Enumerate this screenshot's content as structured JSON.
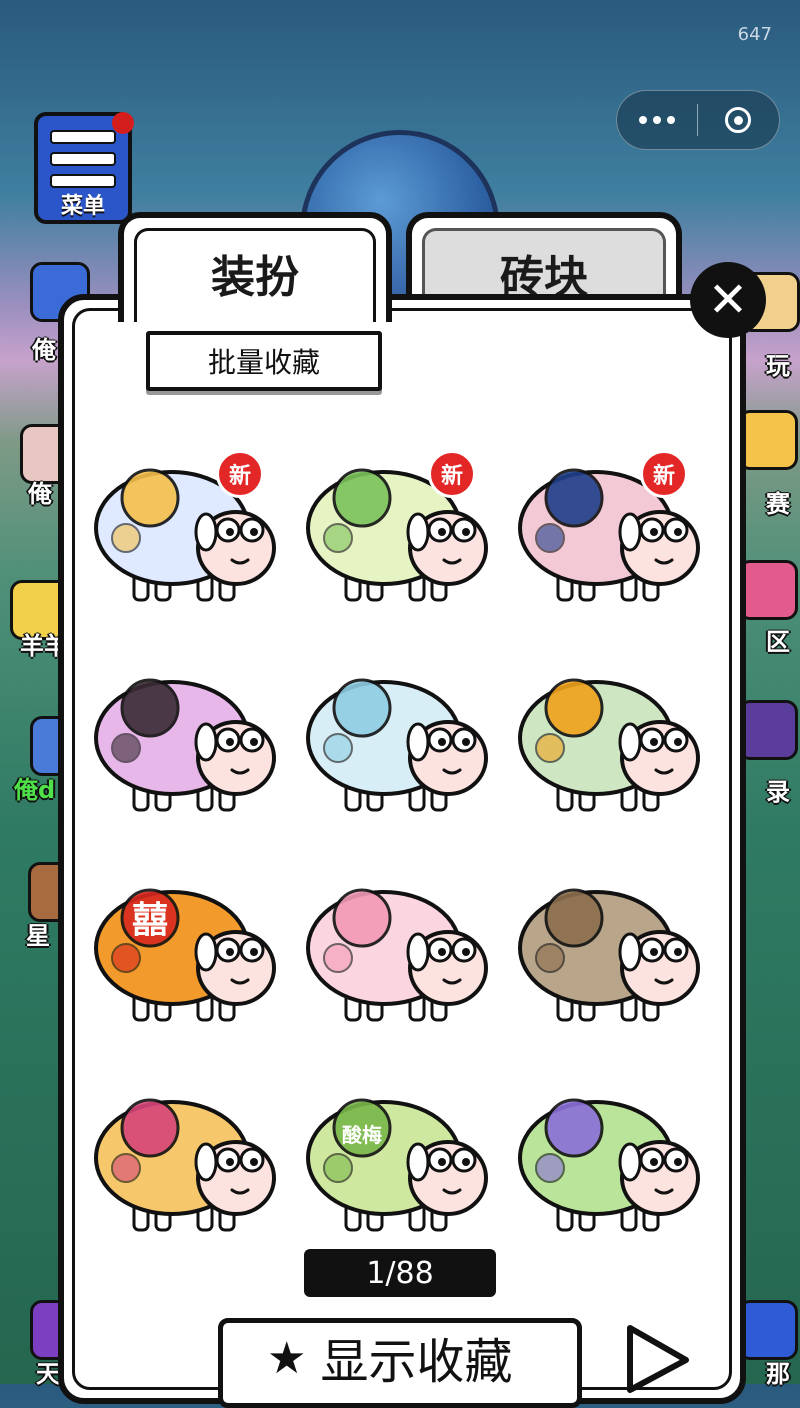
{
  "status": {
    "counter": "647"
  },
  "menu": {
    "label": "菜单"
  },
  "side_left": [
    "俺",
    "俺",
    "羊羊",
    "俺d",
    "星",
    "天"
  ],
  "side_right": [
    "玩",
    "赛",
    "区",
    "录",
    "那"
  ],
  "tabs": [
    {
      "label": "装扮",
      "active": true
    },
    {
      "label": "砖块",
      "active": false
    }
  ],
  "batch_button": "批量收藏",
  "items": [
    {
      "name": "moon-night-sheep",
      "new_badge": "新",
      "body": "#dfe9ff",
      "accent": "#f5c04a"
    },
    {
      "name": "green-fan-girl-sheep",
      "new_badge": "新",
      "body": "#e6f4c4",
      "accent": "#7cc35b"
    },
    {
      "name": "pink-hair-schoolbag-sheep",
      "new_badge": "新",
      "body": "#f4c9d6",
      "accent": "#1f3f8a"
    },
    {
      "name": "witch-halloween-sheep",
      "new_badge": "",
      "body": "#e6b7e8",
      "accent": "#3a2b35"
    },
    {
      "name": "harp-bunny-sheep",
      "new_badge": "",
      "body": "#d8eef6",
      "accent": "#8ecde3"
    },
    {
      "name": "gourd-elder-sheep",
      "new_badge": "",
      "body": "#cfe6c2",
      "accent": "#f0a21b"
    },
    {
      "name": "matchbox-sheep",
      "new_badge": "",
      "body": "#f39a2d",
      "accent": "#d8281e",
      "label": "囍"
    },
    {
      "name": "vanity-table-sheep",
      "new_badge": "",
      "body": "#fbd6e0",
      "accent": "#f49ab6"
    },
    {
      "name": "detective-sheep",
      "new_badge": "",
      "body": "#b9a58a",
      "accent": "#8c6e4c"
    },
    {
      "name": "passionfruit-sheep",
      "new_badge": "",
      "body": "#f7c86b",
      "accent": "#d7457a"
    },
    {
      "name": "plum-drink-sheep",
      "new_badge": "",
      "body": "#cfe89f",
      "accent": "#79b84a",
      "label": "酸梅"
    },
    {
      "name": "cat-garden-sheep",
      "new_badge": "",
      "body": "#b9e49a",
      "accent": "#8b6fd9"
    }
  ],
  "pagination": {
    "current": "1/88"
  },
  "show_favorites": {
    "label": "显示收藏",
    "icon": "star-icon"
  },
  "colors": {
    "panel_border": "#111111",
    "badge_red": "#e32626",
    "bg_green": "#2f7a63"
  }
}
